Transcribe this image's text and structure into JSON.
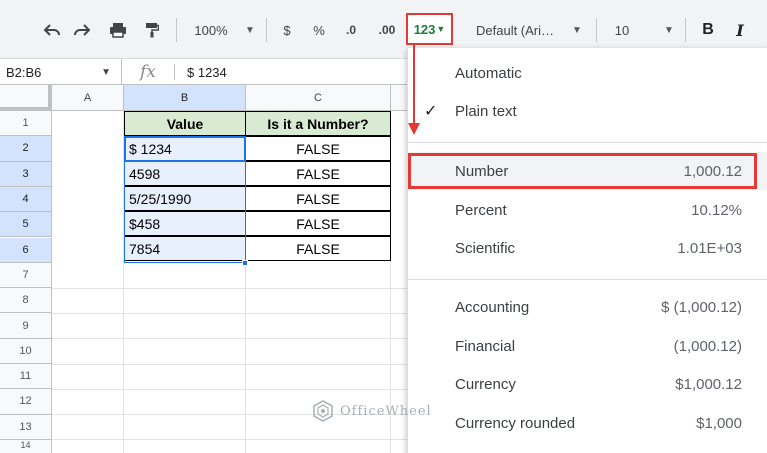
{
  "toolbar": {
    "zoom": "100%",
    "currency_symbol": "$",
    "percent_symbol": "%",
    "decrease_decimal": ".0",
    "increase_decimal": ".00",
    "more_formats_label": "123",
    "font_name": "Default (Ari…",
    "font_size": "10",
    "bold_label": "B",
    "italic_label": "I"
  },
  "formula_bar": {
    "name_box": "B2:B6",
    "fx_label": "fx",
    "value": "$ 1234"
  },
  "grid": {
    "columns": [
      "A",
      "B",
      "C"
    ],
    "rows": [
      "1",
      "2",
      "3",
      "4",
      "5",
      "6",
      "7",
      "8",
      "9",
      "10",
      "11",
      "12",
      "13",
      "14"
    ],
    "table": {
      "headers": [
        "Value",
        "Is it a Number?"
      ],
      "rows": [
        {
          "value": "$ 1234",
          "result": "FALSE"
        },
        {
          "value": "4598",
          "result": "FALSE"
        },
        {
          "value": "5/25/1990",
          "result": "FALSE"
        },
        {
          "value": "$458",
          "result": "FALSE"
        },
        {
          "value": "7854",
          "result": "FALSE"
        }
      ]
    }
  },
  "format_menu": {
    "items": [
      {
        "label": "Automatic",
        "example": ""
      },
      {
        "label": "Plain text",
        "example": "",
        "checked": true
      },
      {
        "label": "Number",
        "example": "1,000.12"
      },
      {
        "label": "Percent",
        "example": "10.12%"
      },
      {
        "label": "Scientific",
        "example": "1.01E+03"
      },
      {
        "label": "Accounting",
        "example": "$ (1,000.12)"
      },
      {
        "label": "Financial",
        "example": "(1,000.12)"
      },
      {
        "label": "Currency",
        "example": "$1,000.12"
      },
      {
        "label": "Currency rounded",
        "example": "$1,000"
      }
    ]
  },
  "watermark": {
    "text": "OfficeWheel"
  },
  "colors": {
    "accent": "#1a73e8",
    "highlight": "#e53935",
    "header_fill": "#d9ead3",
    "selection_fill": "#e8f0fe",
    "more_formats_text": "#188038"
  }
}
